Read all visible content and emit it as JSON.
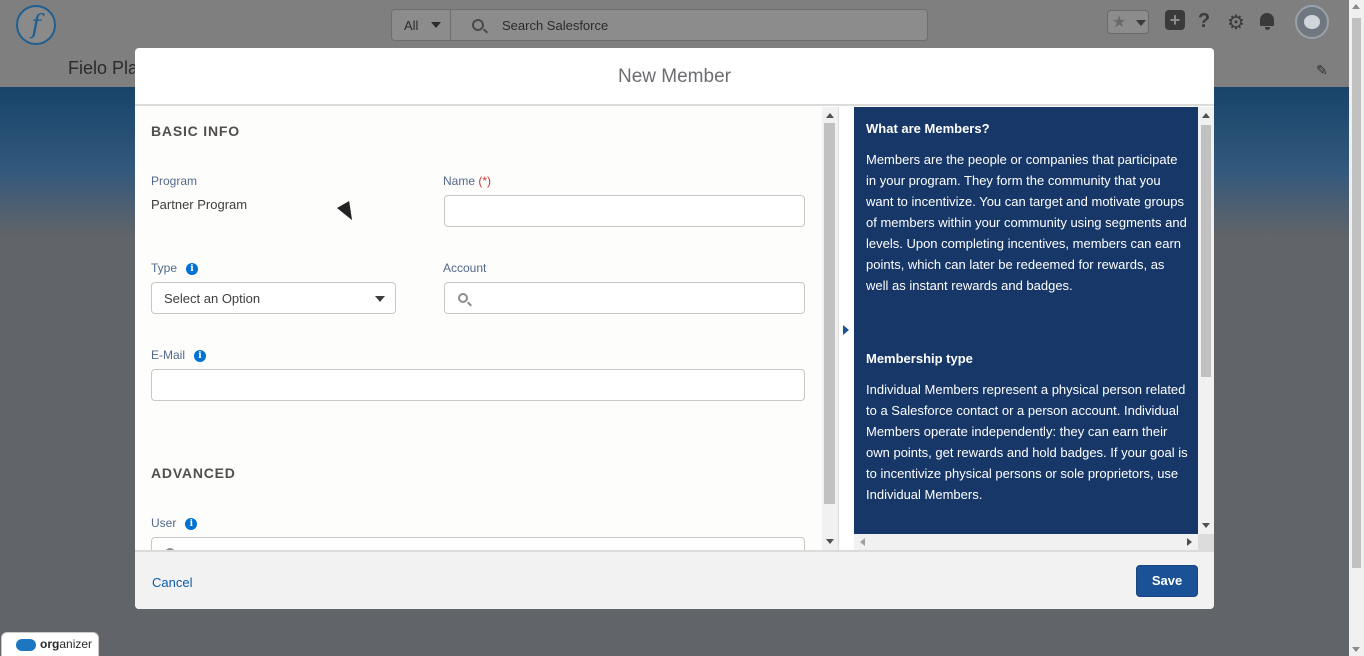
{
  "header": {
    "search_scope": "All",
    "search_placeholder": "Search Salesforce",
    "app_name": "Fielo Pla"
  },
  "modal": {
    "title": "New Member",
    "sections": {
      "basic_info": "BASIC INFO",
      "advanced": "ADVANCED"
    },
    "fields": {
      "program_label": "Program",
      "program_value": "Partner Program",
      "name_label": "Name",
      "required_marker": "(*)",
      "name_value": "",
      "type_label": "Type",
      "type_value": "Select an Option",
      "account_label": "Account",
      "account_value": "",
      "email_label": "E-Mail",
      "email_value": "",
      "user_label": "User"
    },
    "help": {
      "heading1": "What are Members?",
      "body1": "Members are the people or companies that participate in your program. They form the community that you want to incentivize. You can target and motivate groups of members within your community using segments and levels. Upon completing incentives, members can earn points, which can later be redeemed for rewards, as well as instant rewards and badges.",
      "heading2": "Membership type",
      "body2": "Individual Members represent a physical person related to a Salesforce contact or a person account. Individual Members operate independently: they can earn their own points, get rewards and hold badges. If your goal is to incentivize physical persons or sole proprietors, use Individual Members."
    },
    "footer": {
      "cancel_label": "Cancel",
      "save_label": "Save"
    }
  },
  "organizer": {
    "label_bold": "org",
    "label_rest": "anizer"
  },
  "colors": {
    "brand_blue": "#1b5297",
    "help_panel_bg": "#163767",
    "link": "#0b5cab",
    "required": "#c23934",
    "info_icon": "#0070d2"
  },
  "icons": {
    "logo": "fielo-logo-icon",
    "search": "search-icon",
    "favorites": "star-icon",
    "add": "plus-icon",
    "help": "question-icon",
    "settings": "gear-icon",
    "notifications": "bell-icon",
    "apps": "app-launcher-icon",
    "edit": "pencil-icon",
    "info": "info-icon"
  }
}
